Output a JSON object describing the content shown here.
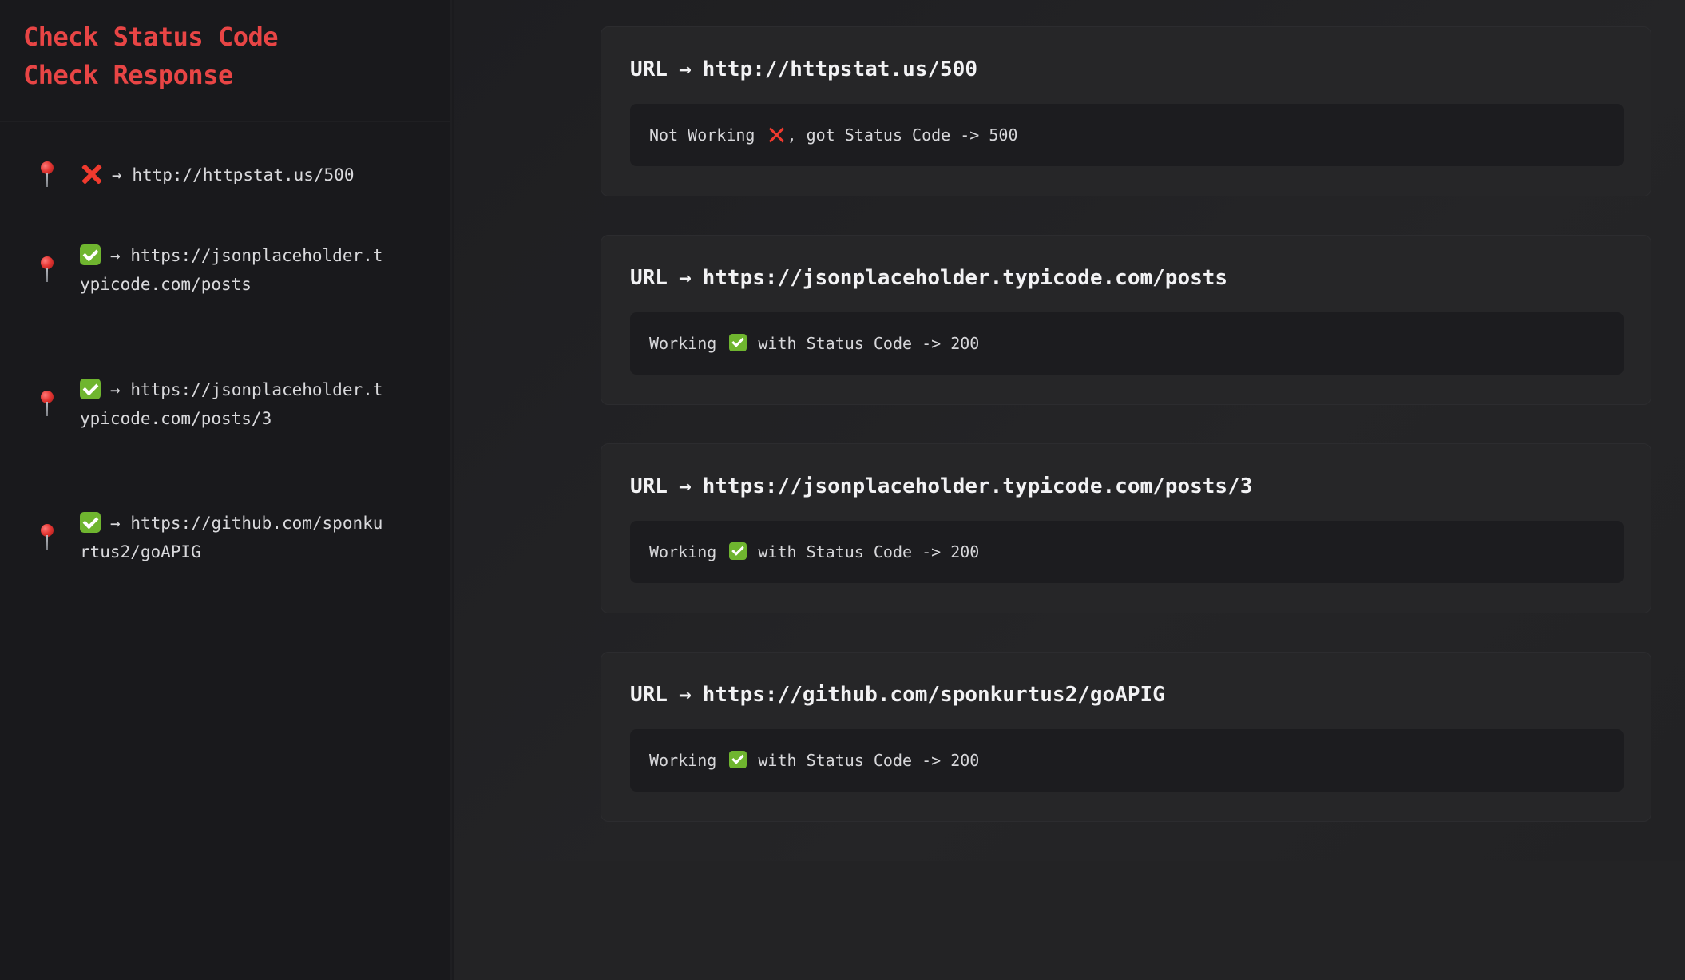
{
  "sidebar": {
    "title_line1": "Check Status Code",
    "title_line2": "Check Response",
    "arrow": "→",
    "items": [
      {
        "status": "bad",
        "url": "http://httpstat.us/500"
      },
      {
        "status": "ok",
        "url": "https://jsonplaceholder.typicode.com/posts"
      },
      {
        "status": "ok",
        "url": "https://jsonplaceholder.typicode.com/posts/3"
      },
      {
        "status": "ok",
        "url": "https://github.com/sponkurtus2/goAPIG"
      }
    ]
  },
  "cards": {
    "url_label": "URL",
    "arrow": "→",
    "items": [
      {
        "url": "http://httpstat.us/500",
        "status": "bad",
        "message_pre": "Not Working",
        "message_post": ", got Status Code -> 500"
      },
      {
        "url": "https://jsonplaceholder.typicode.com/posts",
        "status": "ok",
        "message_pre": "Working",
        "message_post": " with Status Code -> 200"
      },
      {
        "url": "https://jsonplaceholder.typicode.com/posts/3",
        "status": "ok",
        "message_pre": "Working",
        "message_post": " with Status Code -> 200"
      },
      {
        "url": "https://github.com/sponkurtus2/goAPIG",
        "status": "ok",
        "message_pre": "Working",
        "message_post": " with Status Code -> 200"
      }
    ]
  },
  "colors": {
    "accent": "#e84545",
    "ok": "#6fb52f",
    "bad": "#f03a2e"
  },
  "icons": {
    "pin": "round-pushpin-icon",
    "ok": "check-mark-button-icon",
    "bad": "cross-mark-icon"
  }
}
